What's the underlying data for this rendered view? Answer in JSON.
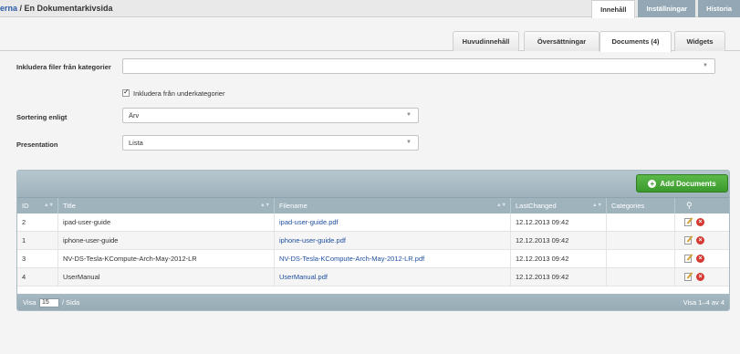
{
  "breadcrumb": {
    "link": "erna",
    "separator": " / ",
    "current": "En Dokumentarkivsida"
  },
  "top_tabs": [
    {
      "label": "Innehåll",
      "active": true
    },
    {
      "label": "Inställningar",
      "active": false
    },
    {
      "label": "Historia",
      "active": false
    }
  ],
  "sub_tabs": [
    {
      "label": "Huvudinnehåll",
      "active": false
    },
    {
      "label": "Översättningar",
      "active": false
    },
    {
      "label": "Documents (4)",
      "active": true
    },
    {
      "label": "Widgets",
      "active": false
    }
  ],
  "form": {
    "categories_label": "Inkludera filer från kategorier",
    "categories_value": "",
    "subcategories_label": "Inkludera från underkategorier",
    "subcategories_checked": true,
    "sort_label": "Sortering enligt",
    "sort_value": "Ärv",
    "presentation_label": "Presentation",
    "presentation_value": "Lista"
  },
  "grid": {
    "add_button": "Add Documents",
    "columns": [
      "ID",
      "Title",
      "Filename",
      "LastChanged",
      "Categories"
    ],
    "rows": [
      {
        "id": "2",
        "title": "ipad-user-guide",
        "filename": "ipad-user-guide.pdf",
        "last_changed": "12.12.2013 09:42",
        "categories": ""
      },
      {
        "id": "1",
        "title": "iphone-user-guide",
        "filename": "iphone-user-guide.pdf",
        "last_changed": "12.12.2013 09:42",
        "categories": ""
      },
      {
        "id": "3",
        "title": "NV-DS-Tesla-KCompute-Arch-May-2012-LR",
        "filename": "NV-DS-Tesla-KCompute-Arch-May-2012-LR.pdf",
        "last_changed": "12.12.2013 09:42",
        "categories": ""
      },
      {
        "id": "4",
        "title": "UserManual",
        "filename": "UserManual.pdf",
        "last_changed": "12.12.2013 09:42",
        "categories": ""
      }
    ],
    "footer": {
      "show_label": "Visa",
      "per_page": "15",
      "unit": "/ Sida",
      "count": "Visa 1–4 av 4"
    }
  },
  "colors": {
    "accent_green": "#3b9a2c",
    "grid_header": "#9fb3bd",
    "link": "#1f4fa0",
    "delete_red": "#d53a32"
  }
}
